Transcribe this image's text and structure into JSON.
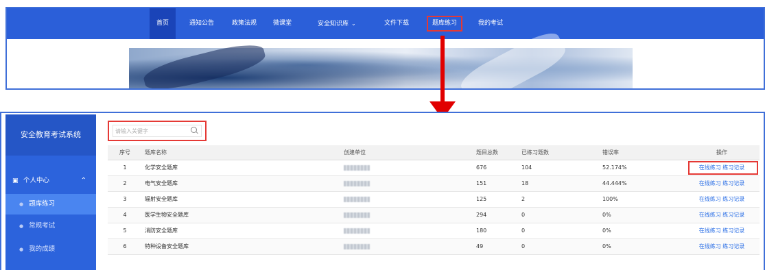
{
  "top_site": {
    "nav": [
      {
        "label": "首页",
        "active": true
      },
      {
        "label": "通知公告"
      },
      {
        "label": "政策法规"
      },
      {
        "label": "微课堂"
      },
      {
        "label": "安全知识库",
        "has_dropdown": true
      },
      {
        "label": "文件下载"
      },
      {
        "label": "题库练习",
        "highlighted": true
      },
      {
        "label": "我的考试"
      }
    ],
    "dropdown_icon": "chevron-down-icon"
  },
  "admin": {
    "sidebar": {
      "title": "安全教育考试系统",
      "group": {
        "label": "个人中心",
        "icon": "user-group-icon",
        "expanded_icon": "chevron-up-icon"
      },
      "items": [
        {
          "label": "题库练习",
          "active": true
        },
        {
          "label": "常规考试"
        },
        {
          "label": "我的成绩"
        }
      ]
    },
    "search": {
      "placeholder": "请输入关键字",
      "value": ""
    },
    "table": {
      "headers": [
        "序号",
        "题库名称",
        "创建单位",
        "题目总数",
        "已练习题数",
        "错误率",
        "操作"
      ],
      "rows": [
        {
          "index": "1",
          "name": "化学安全题库",
          "total": "676",
          "practiced": "104",
          "error_rate": "52.174%"
        },
        {
          "index": "2",
          "name": "电气安全题库",
          "total": "151",
          "practiced": "18",
          "error_rate": "44.444%"
        },
        {
          "index": "3",
          "name": "辐射安全题库",
          "total": "125",
          "practiced": "2",
          "error_rate": "100%"
        },
        {
          "index": "4",
          "name": "医学生物安全题库",
          "total": "294",
          "practiced": "0",
          "error_rate": "0%"
        },
        {
          "index": "5",
          "name": "消防安全题库",
          "total": "180",
          "practiced": "0",
          "error_rate": "0%"
        },
        {
          "index": "6",
          "name": "特种设备安全题库",
          "total": "49",
          "practiced": "0",
          "error_rate": "0%"
        }
      ],
      "action_online": "在线练习",
      "action_record": "练习记录"
    }
  },
  "colors": {
    "nav_bg": "#2b5fd9",
    "sidebar_bg": "#2c63dc",
    "highlight": "#e53935",
    "arrow": "#e10000",
    "link": "#2b6fe6"
  }
}
